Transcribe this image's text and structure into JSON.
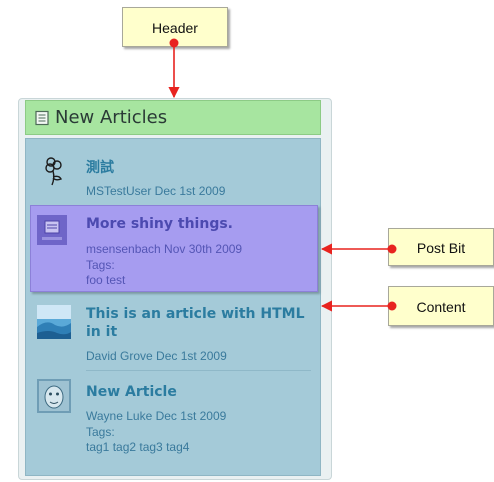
{
  "callouts": {
    "header": "Header",
    "post_bit": "Post Bit",
    "content": "Content"
  },
  "widget": {
    "title": "New Articles",
    "articles": [
      {
        "title": "測試",
        "author_date": "MSTestUser Dec 1st 2009",
        "thumb_icon": "flower-icon"
      },
      {
        "title": "More shiny things.",
        "author_date": "msensenbach Nov 30th 2009",
        "tags_label": "Tags:",
        "tags": "foo test",
        "thumb_icon": "no-image-icon"
      },
      {
        "title": "This is an article with HTML in it",
        "author_date": "David Grove Dec 1st 2009",
        "thumb_icon": "landscape-thumbnail"
      },
      {
        "title": "New Article",
        "author_date": "Wayne Luke Dec 1st 2009",
        "tags_label": "Tags:",
        "tags": "tag1 tag2 tag3 tag4",
        "thumb_icon": "face-thumbnail"
      }
    ]
  },
  "colors": {
    "callout_bg": "#ffffcc",
    "arrow": "#e8231f",
    "header_bg": "#a7e5a0",
    "body_bg": "#a4cad8",
    "postbit_bg": "#a69cf0",
    "link": "#2b7ca0"
  }
}
